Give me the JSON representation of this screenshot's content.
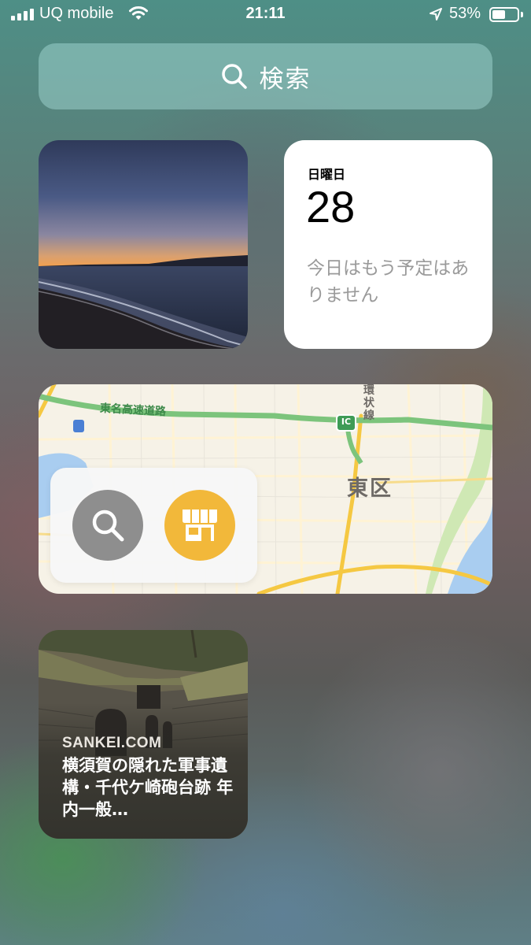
{
  "status_bar": {
    "carrier": "UQ mobile",
    "time": "21:11",
    "battery_percent": "53%",
    "battery_level": 0.53,
    "signal_bars": 4
  },
  "search": {
    "label": "検索",
    "icon": "search-icon"
  },
  "calendar_widget": {
    "weekday": "日曜日",
    "date": "28",
    "no_events": "今日はもう予定はありません"
  },
  "photo_widget": {
    "subject": "sunset-beach-photo"
  },
  "map_widget": {
    "expressway_label": "東名高速道路",
    "interchange_badge": "IC",
    "ring_road_label": "環状線",
    "district": "東区",
    "buttons": {
      "search": "search-icon",
      "shop": "storefront-icon"
    }
  },
  "news_widget": {
    "source": "SANKEI.COM",
    "headline": "横須賀の隠れた軍事遺構・千代ケ崎砲台跡 年内一般…"
  },
  "colors": {
    "map_shop_button": "#f2b83a",
    "map_search_button": "#8e8e8e",
    "expressway": "#7cc47c",
    "arterial_road": "#f5c842"
  }
}
